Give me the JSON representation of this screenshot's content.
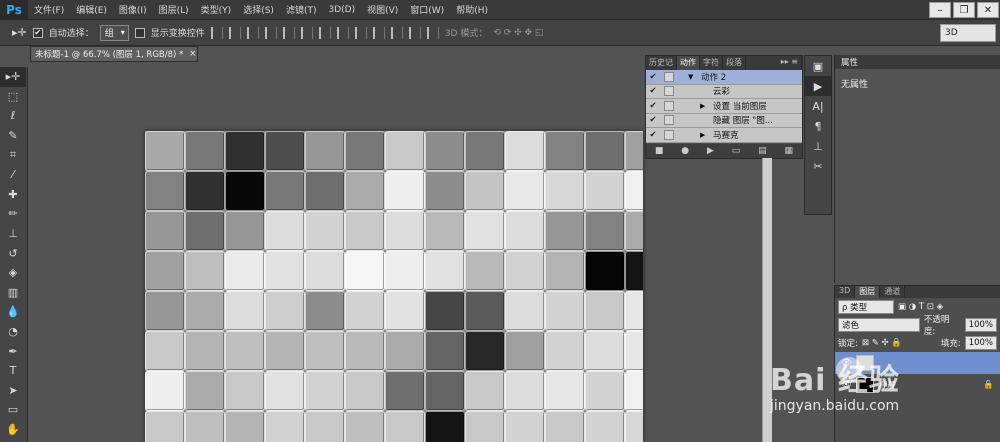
{
  "app": {
    "logo": "Ps"
  },
  "menu": [
    "文件(F)",
    "编辑(E)",
    "图像(I)",
    "图层(L)",
    "类型(Y)",
    "选择(S)",
    "滤镜(T)",
    "3D(D)",
    "视图(V)",
    "窗口(W)",
    "帮助(H)"
  ],
  "window_controls": [
    "–",
    "❐",
    "✕"
  ],
  "options": {
    "auto_select_label": "自动选择：",
    "auto_select_value": "组",
    "show_transform_label": "显示变换控件",
    "mode_3d_label": "3D 模式：",
    "workspace": "3D"
  },
  "document": {
    "tab_title": "未标题-1 @ 66.7% (图层 1, RGB/8) *",
    "close": "×"
  },
  "actions_panel": {
    "tabs": [
      "历史记",
      "动作",
      "字符",
      "段落"
    ],
    "rows": [
      {
        "check": "✔",
        "triangle": "▼",
        "label": "动作 2",
        "highlight": true
      },
      {
        "check": "✔",
        "triangle": "",
        "label": "云彩",
        "highlight": false
      },
      {
        "check": "✔",
        "triangle": "▶",
        "label": "设置 当前图层",
        "highlight": false
      },
      {
        "check": "✔",
        "triangle": "",
        "label": "隐藏 图层 \"图...",
        "highlight": false
      },
      {
        "check": "✔",
        "triangle": "▶",
        "label": "马赛克",
        "highlight": false
      }
    ],
    "footer_icons": [
      "■",
      "●",
      "▶",
      "▭",
      "▤",
      "▦"
    ]
  },
  "properties_panel": {
    "title": "属性",
    "body": "无属性"
  },
  "layers_panel": {
    "tabs": [
      "3D",
      "图层",
      "通道"
    ],
    "filter_label": "ρ 类型",
    "blend_mode": "滤色",
    "opacity_label": "不透明度:",
    "opacity_value": "100%",
    "lock_label": "锁定:",
    "fill_label": "填充:",
    "fill_value": "100%",
    "layer_background_label": "背景"
  },
  "watermark": {
    "main": "Bai 经验",
    "sub": "jingyan.baidu.com"
  },
  "canvas_tiles": {
    "cols": 13,
    "rows": 8,
    "grays": [
      168,
      120,
      48,
      78,
      150,
      120,
      200,
      140,
      120,
      220,
      130,
      110,
      160,
      130,
      48,
      8,
      120,
      110,
      170,
      238,
      140,
      196,
      232,
      215,
      210,
      240,
      150,
      110,
      150,
      220,
      210,
      200,
      220,
      185,
      225,
      220,
      150,
      130,
      170,
      160,
      190,
      234,
      225,
      220,
      245,
      238,
      225,
      185,
      210,
      180,
      5,
      20,
      150,
      170,
      220,
      205,
      140,
      210,
      226,
      70,
      90,
      220,
      210,
      200,
      230,
      200,
      180,
      190,
      180,
      190,
      185,
      170,
      100,
      40,
      160,
      210,
      220,
      230,
      238,
      170,
      200,
      225,
      210,
      200,
      110,
      100,
      200,
      220,
      230,
      210,
      240,
      200,
      190,
      180,
      210,
      200,
      190,
      200,
      20,
      200,
      210,
      200,
      210,
      215
    ]
  }
}
